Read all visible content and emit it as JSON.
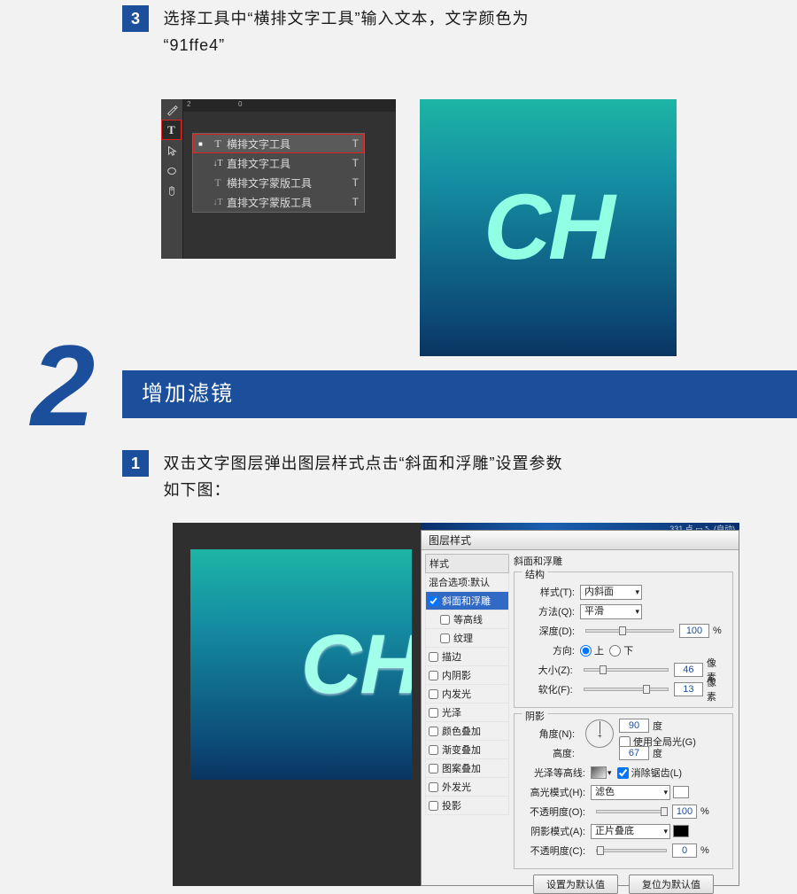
{
  "step3": {
    "number": "3",
    "text_line1": "选择工具中“横排文字工具”输入文本，文字颜色为",
    "text_line2": "“91ffe4”"
  },
  "tools": {
    "ruler_marks": [
      "2",
      "0"
    ],
    "items": [
      {
        "icon": "T",
        "dotted": false,
        "label": "横排文字工具",
        "shortcut": "T",
        "selected": true
      },
      {
        "icon": "↓T",
        "dotted": true,
        "label": "直排文字工具",
        "shortcut": "T",
        "selected": false
      },
      {
        "icon": "T",
        "dotted": true,
        "label": "横排文字蒙版工具",
        "shortcut": "T",
        "selected": false
      },
      {
        "icon": "↓T",
        "dotted": true,
        "label": "直排文字蒙版工具",
        "shortcut": "T",
        "selected": false
      }
    ]
  },
  "preview_text": "CH",
  "section2": {
    "big_number": "2",
    "title": "增加滤镜"
  },
  "step1": {
    "number": "1",
    "text_line1": "双击文字图层弹出图层样式点击“斜面和浮雕”设置参数",
    "text_line2": "如下图："
  },
  "dlg_topinfo": "331 点   ▭ ⤡ (自动)",
  "dialog": {
    "title": "图层样式",
    "left": {
      "header1": "样式",
      "header2": "混合选项:默认",
      "rows": [
        {
          "label": "斜面和浮雕",
          "checked": true,
          "selected": true,
          "indent": false
        },
        {
          "label": "等高线",
          "checked": false,
          "selected": false,
          "indent": true
        },
        {
          "label": "纹理",
          "checked": false,
          "selected": false,
          "indent": true
        },
        {
          "label": "描边",
          "checked": false,
          "selected": false,
          "indent": false
        },
        {
          "label": "内阴影",
          "checked": false,
          "selected": false,
          "indent": false
        },
        {
          "label": "内发光",
          "checked": false,
          "selected": false,
          "indent": false
        },
        {
          "label": "光泽",
          "checked": false,
          "selected": false,
          "indent": false
        },
        {
          "label": "颜色叠加",
          "checked": false,
          "selected": false,
          "indent": false
        },
        {
          "label": "渐变叠加",
          "checked": false,
          "selected": false,
          "indent": false
        },
        {
          "label": "图案叠加",
          "checked": false,
          "selected": false,
          "indent": false
        },
        {
          "label": "外发光",
          "checked": false,
          "selected": false,
          "indent": false
        },
        {
          "label": "投影",
          "checked": false,
          "selected": false,
          "indent": false
        }
      ]
    },
    "panel_title": "斜面和浮雕",
    "structure": {
      "legend": "结构",
      "style_label": "样式(T):",
      "style_value": "内斜面",
      "method_label": "方法(Q):",
      "method_value": "平滑",
      "depth_label": "深度(D):",
      "depth_value": "100",
      "depth_unit": "%",
      "dir_label": "方向:",
      "dir_up": "上",
      "dir_down": "下",
      "size_label": "大小(Z):",
      "size_value": "46",
      "size_unit": "像素",
      "soften_label": "软化(F):",
      "soften_value": "13",
      "soften_unit": "像素"
    },
    "shading": {
      "legend": "阴影",
      "angle_label": "角度(N):",
      "angle_value": "90",
      "angle_unit": "度",
      "global_label": "使用全局光(G)",
      "altitude_label": "高度:",
      "altitude_value": "67",
      "altitude_unit": "度",
      "gloss_label": "光泽等高线:",
      "antialias_label": "消除锯齿(L)",
      "hl_mode_label": "高光模式(H):",
      "hl_mode_value": "滤色",
      "hl_opacity_label": "不透明度(O):",
      "hl_opacity_value": "100",
      "pct": "%",
      "sh_mode_label": "阴影模式(A):",
      "sh_mode_value": "正片叠底",
      "sh_opacity_label": "不透明度(C):",
      "sh_opacity_value": "0"
    },
    "buttons": {
      "default": "设置为默认值",
      "reset": "复位为默认值"
    }
  }
}
